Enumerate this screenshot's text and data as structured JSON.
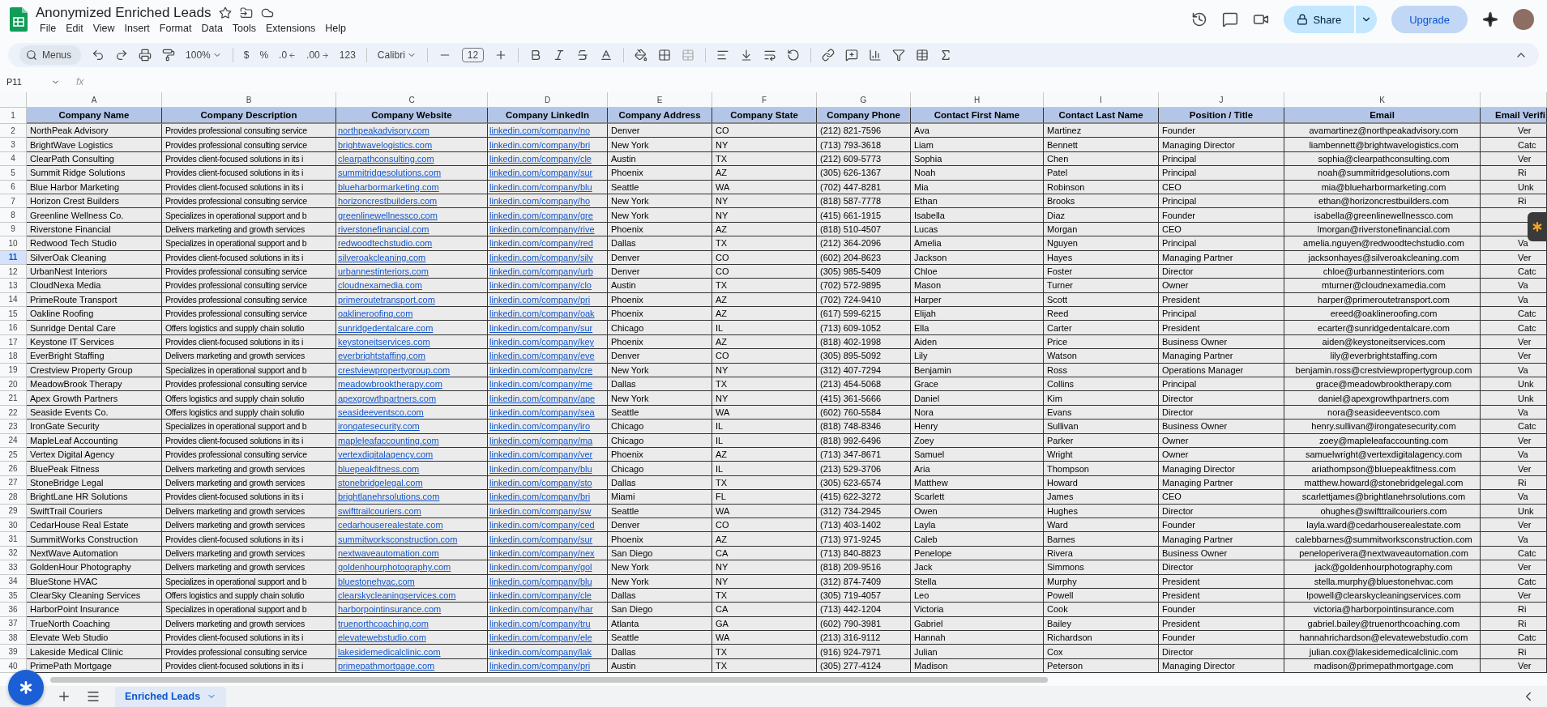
{
  "document": {
    "title": "Anonymized Enriched Leads"
  },
  "menu": [
    "File",
    "Edit",
    "View",
    "Insert",
    "Format",
    "Data",
    "Tools",
    "Extensions",
    "Help"
  ],
  "share_button": "Share",
  "upgrade_button": "Upgrade",
  "toolbar": {
    "search": "Menus",
    "zoom": "100%",
    "currency": "$",
    "percent": "%",
    "decrease_decimal": ".0",
    "increase_decimal": ".00",
    "number_format": "123",
    "font": "Calibri",
    "font_size": "12"
  },
  "name_box": "P11",
  "formula_label": "fx",
  "columns": [
    {
      "letter": "A",
      "header": "Company Name",
      "kind": "text"
    },
    {
      "letter": "B",
      "header": "Company Description",
      "kind": "desc"
    },
    {
      "letter": "C",
      "header": "Company Website",
      "kind": "link"
    },
    {
      "letter": "D",
      "header": "Company LinkedIn",
      "kind": "link"
    },
    {
      "letter": "E",
      "header": "Company Address",
      "kind": "text"
    },
    {
      "letter": "F",
      "header": "Company State",
      "kind": "text"
    },
    {
      "letter": "G",
      "header": "Company Phone",
      "kind": "text"
    },
    {
      "letter": "H",
      "header": "Contact First Name",
      "kind": "text"
    },
    {
      "letter": "I",
      "header": "Contact Last Name",
      "kind": "text"
    },
    {
      "letter": "J",
      "header": "Position / Title",
      "kind": "text"
    },
    {
      "letter": "K",
      "header": "Email",
      "kind": "center"
    },
    {
      "header": "Email Verifi",
      "kind": "clipped"
    }
  ],
  "header_row": {
    "number": "1"
  },
  "rows": [
    {
      "number": "2",
      "selected": false,
      "cells": [
        "NorthPeak Advisory",
        "Provides professional consulting service",
        "northpeakadvisory.com",
        "linkedin.com/company/no",
        "Denver",
        "CO",
        "(212) 821-7596",
        "Ava",
        "Martinez",
        "Founder",
        "avamartinez@northpeakadvisory.com",
        "Ver"
      ]
    },
    {
      "number": "3",
      "selected": false,
      "cells": [
        "BrightWave Logistics",
        "Provides professional consulting service",
        "brightwavelogistics.com",
        "linkedin.com/company/bri",
        "New York",
        "NY",
        "(713) 793-3618",
        "Liam",
        "Bennett",
        "Managing Director",
        "liambennett@brightwavelogistics.com",
        "Catc"
      ]
    },
    {
      "number": "4",
      "selected": false,
      "cells": [
        "ClearPath Consulting",
        "Provides client-focused solutions in its i",
        "clearpathconsulting.com",
        "linkedin.com/company/cle",
        "Austin",
        "TX",
        "(212) 609-5773",
        "Sophia",
        "Chen",
        "Principal",
        "sophia@clearpathconsulting.com",
        "Ver"
      ]
    },
    {
      "number": "5",
      "selected": false,
      "cells": [
        "Summit Ridge Solutions",
        "Provides client-focused solutions in its i",
        "summitridgesolutions.com",
        "linkedin.com/company/sur",
        "Phoenix",
        "AZ",
        "(305) 626-1367",
        "Noah",
        "Patel",
        "Principal",
        "noah@summitridgesolutions.com",
        "Ri"
      ]
    },
    {
      "number": "6",
      "selected": false,
      "cells": [
        "Blue Harbor Marketing",
        "Provides client-focused solutions in its i",
        "blueharbormarketing.com",
        "linkedin.com/company/blu",
        "Seattle",
        "WA",
        "(702) 447-8281",
        "Mia",
        "Robinson",
        "CEO",
        "mia@blueharbormarketing.com",
        "Unk"
      ]
    },
    {
      "number": "7",
      "selected": false,
      "cells": [
        "Horizon Crest Builders",
        "Provides professional consulting service",
        "horizoncrestbuilders.com",
        "linkedin.com/company/ho",
        "New York",
        "NY",
        "(818) 587-7778",
        "Ethan",
        "Brooks",
        "Principal",
        "ethan@horizoncrestbuilders.com",
        "Ri"
      ]
    },
    {
      "number": "8",
      "selected": false,
      "cells": [
        "Greenline Wellness Co.",
        "Specializes in operational support and b",
        "greenlinewellnessco.com",
        "linkedin.com/company/gre",
        "New York",
        "NY",
        "(415) 661-1915",
        "Isabella",
        "Diaz",
        "Founder",
        "isabella@greenlinewellnessco.com"
      ]
    },
    {
      "number": "9",
      "selected": false,
      "cells": [
        "Riverstone Financial",
        "Delivers marketing and growth services",
        "riverstonefinancial.com",
        "linkedin.com/company/rive",
        "Phoenix",
        "AZ",
        "(818) 510-4507",
        "Lucas",
        "Morgan",
        "CEO",
        "lmorgan@riverstonefinancial.com"
      ]
    },
    {
      "number": "10",
      "selected": false,
      "cells": [
        "Redwood Tech Studio",
        "Specializes in operational support and b",
        "redwoodtechstudio.com",
        "linkedin.com/company/red",
        "Dallas",
        "TX",
        "(212) 364-2096",
        "Amelia",
        "Nguyen",
        "Principal",
        "amelia.nguyen@redwoodtechstudio.com",
        "Va"
      ]
    },
    {
      "number": "11",
      "selected": true,
      "cells": [
        "SilverOak Cleaning",
        "Provides client-focused solutions in its i",
        "silveroakcleaning.com",
        "linkedin.com/company/silv",
        "Denver",
        "CO",
        "(602) 204-8623",
        "Jackson",
        "Hayes",
        "Managing Partner",
        "jacksonhayes@silveroakcleaning.com",
        "Ver"
      ]
    },
    {
      "number": "12",
      "selected": false,
      "cells": [
        "UrbanNest Interiors",
        "Provides professional consulting service",
        "urbannestinteriors.com",
        "linkedin.com/company/urb",
        "Denver",
        "CO",
        "(305) 985-5409",
        "Chloe",
        "Foster",
        "Director",
        "chloe@urbannestinteriors.com",
        "Catc"
      ]
    },
    {
      "number": "13",
      "selected": false,
      "cells": [
        "CloudNexa Media",
        "Provides professional consulting service",
        "cloudnexamedia.com",
        "linkedin.com/company/clo",
        "Austin",
        "TX",
        "(702) 572-9895",
        "Mason",
        "Turner",
        "Owner",
        "mturner@cloudnexamedia.com",
        "Va"
      ]
    },
    {
      "number": "14",
      "selected": false,
      "cells": [
        "PrimeRoute Transport",
        "Provides professional consulting service",
        "primeroutetransport.com",
        "linkedin.com/company/pri",
        "Phoenix",
        "AZ",
        "(702) 724-9410",
        "Harper",
        "Scott",
        "President",
        "harper@primeroutetransport.com",
        "Va"
      ]
    },
    {
      "number": "15",
      "selected": false,
      "cells": [
        "Oakline Roofing",
        "Provides professional consulting service",
        "oaklineroofing.com",
        "linkedin.com/company/oak",
        "Phoenix",
        "AZ",
        "(617) 599-6215",
        "Elijah",
        "Reed",
        "Principal",
        "ereed@oaklineroofing.com",
        "Catc"
      ]
    },
    {
      "number": "16",
      "selected": false,
      "cells": [
        "Sunridge Dental Care",
        "Offers logistics and supply chain solutio",
        "sunridgedentalcare.com",
        "linkedin.com/company/sur",
        "Chicago",
        "IL",
        "(713) 609-1052",
        "Ella",
        "Carter",
        "President",
        "ecarter@sunridgedentalcare.com",
        "Catc"
      ]
    },
    {
      "number": "17",
      "selected": false,
      "cells": [
        "Keystone IT Services",
        "Provides client-focused solutions in its i",
        "keystoneitservices.com",
        "linkedin.com/company/key",
        "Phoenix",
        "AZ",
        "(818) 402-1998",
        "Aiden",
        "Price",
        "Business Owner",
        "aiden@keystoneitservices.com",
        "Ver"
      ]
    },
    {
      "number": "18",
      "selected": false,
      "cells": [
        "EverBright Staffing",
        "Delivers marketing and growth services",
        "everbrightstaffing.com",
        "linkedin.com/company/eve",
        "Denver",
        "CO",
        "(305) 895-5092",
        "Lily",
        "Watson",
        "Managing Partner",
        "lily@everbrightstaffing.com",
        "Ver"
      ]
    },
    {
      "number": "19",
      "selected": false,
      "cells": [
        "Crestview Property Group",
        "Specializes in operational support and b",
        "crestviewpropertygroup.com",
        "linkedin.com/company/cre",
        "New York",
        "NY",
        "(312) 407-7294",
        "Benjamin",
        "Ross",
        "Operations Manager",
        "benjamin.ross@crestviewpropertygroup.com",
        "Va"
      ]
    },
    {
      "number": "20",
      "selected": false,
      "cells": [
        "MeadowBrook Therapy",
        "Provides professional consulting service",
        "meadowbrooktherapy.com",
        "linkedin.com/company/me",
        "Dallas",
        "TX",
        "(213) 454-5068",
        "Grace",
        "Collins",
        "Principal",
        "grace@meadowbrooktherapy.com",
        "Unk"
      ]
    },
    {
      "number": "21",
      "selected": false,
      "cells": [
        "Apex Growth Partners",
        "Offers logistics and supply chain solutio",
        "apexgrowthpartners.com",
        "linkedin.com/company/ape",
        "New York",
        "NY",
        "(415) 361-5666",
        "Daniel",
        "Kim",
        "Director",
        "daniel@apexgrowthpartners.com",
        "Unk"
      ]
    },
    {
      "number": "22",
      "selected": false,
      "cells": [
        "Seaside Events Co.",
        "Offers logistics and supply chain solutio",
        "seasideeventsco.com",
        "linkedin.com/company/sea",
        "Seattle",
        "WA",
        "(602) 760-5584",
        "Nora",
        "Evans",
        "Director",
        "nora@seasideeventsco.com",
        "Va"
      ]
    },
    {
      "number": "23",
      "selected": false,
      "cells": [
        "IronGate Security",
        "Specializes in operational support and b",
        "irongatesecurity.com",
        "linkedin.com/company/iro",
        "Chicago",
        "IL",
        "(818) 748-8346",
        "Henry",
        "Sullivan",
        "Business Owner",
        "henry.sullivan@irongatesecurity.com",
        "Catc"
      ]
    },
    {
      "number": "24",
      "selected": false,
      "cells": [
        "MapleLeaf Accounting",
        "Provides client-focused solutions in its i",
        "mapleleafaccounting.com",
        "linkedin.com/company/ma",
        "Chicago",
        "IL",
        "(818) 992-6496",
        "Zoey",
        "Parker",
        "Owner",
        "zoey@mapleleafaccounting.com",
        "Ver"
      ]
    },
    {
      "number": "25",
      "selected": false,
      "cells": [
        "Vertex Digital Agency",
        "Provides professional consulting service",
        "vertexdigitalagency.com",
        "linkedin.com/company/ver",
        "Phoenix",
        "AZ",
        "(713) 347-8671",
        "Samuel",
        "Wright",
        "Owner",
        "samuelwright@vertexdigitalagency.com",
        "Va"
      ]
    },
    {
      "number": "26",
      "selected": false,
      "cells": [
        "BluePeak Fitness",
        "Delivers marketing and growth services",
        "bluepeakfitness.com",
        "linkedin.com/company/blu",
        "Chicago",
        "IL",
        "(213) 529-3706",
        "Aria",
        "Thompson",
        "Managing Director",
        "ariathompson@bluepeakfitness.com",
        "Ver"
      ]
    },
    {
      "number": "27",
      "selected": false,
      "cells": [
        "StoneBridge Legal",
        "Delivers marketing and growth services",
        "stonebridgelegal.com",
        "linkedin.com/company/sto",
        "Dallas",
        "TX",
        "(305) 623-6574",
        "Matthew",
        "Howard",
        "Managing Partner",
        "matthew.howard@stonebridgelegal.com",
        "Ri"
      ]
    },
    {
      "number": "28",
      "selected": false,
      "cells": [
        "BrightLane HR Solutions",
        "Provides client-focused solutions in its i",
        "brightlanehrsolutions.com",
        "linkedin.com/company/bri",
        "Miami",
        "FL",
        "(415) 622-3272",
        "Scarlett",
        "James",
        "CEO",
        "scarlettjames@brightlanehrsolutions.com",
        "Va"
      ]
    },
    {
      "number": "29",
      "selected": false,
      "cells": [
        "SwiftTrail Couriers",
        "Delivers marketing and growth services",
        "swifttrailcouriers.com",
        "linkedin.com/company/sw",
        "Seattle",
        "WA",
        "(312) 734-2945",
        "Owen",
        "Hughes",
        "Director",
        "ohughes@swifttrailcouriers.com",
        "Unk"
      ]
    },
    {
      "number": "30",
      "selected": false,
      "cells": [
        "CedarHouse Real Estate",
        "Delivers marketing and growth services",
        "cedarhouserealestate.com",
        "linkedin.com/company/ced",
        "Denver",
        "CO",
        "(713) 403-1402",
        "Layla",
        "Ward",
        "Founder",
        "layla.ward@cedarhouserealestate.com",
        "Ver"
      ]
    },
    {
      "number": "31",
      "selected": false,
      "cells": [
        "SummitWorks Construction",
        "Provides client-focused solutions in its i",
        "summitworksconstruction.com",
        "linkedin.com/company/sur",
        "Phoenix",
        "AZ",
        "(713) 971-9245",
        "Caleb",
        "Barnes",
        "Managing Partner",
        "calebbarnes@summitworksconstruction.com",
        "Va"
      ]
    },
    {
      "number": "32",
      "selected": false,
      "cells": [
        "NextWave Automation",
        "Delivers marketing and growth services",
        "nextwaveautomation.com",
        "linkedin.com/company/nex",
        "San Diego",
        "CA",
        "(713) 840-8823",
        "Penelope",
        "Rivera",
        "Business Owner",
        "peneloperivera@nextwaveautomation.com",
        "Catc"
      ]
    },
    {
      "number": "33",
      "selected": false,
      "cells": [
        "GoldenHour Photography",
        "Delivers marketing and growth services",
        "goldenhourphotography.com",
        "linkedin.com/company/gol",
        "New York",
        "NY",
        "(818) 209-9516",
        "Jack",
        "Simmons",
        "Director",
        "jack@goldenhourphotography.com",
        "Ver"
      ]
    },
    {
      "number": "34",
      "selected": false,
      "cells": [
        "BlueStone HVAC",
        "Specializes in operational support and b",
        "bluestonehvac.com",
        "linkedin.com/company/blu",
        "New York",
        "NY",
        "(312) 874-7409",
        "Stella",
        "Murphy",
        "President",
        "stella.murphy@bluestonehvac.com",
        "Catc"
      ]
    },
    {
      "number": "35",
      "selected": false,
      "cells": [
        "ClearSky Cleaning Services",
        "Offers logistics and supply chain solutio",
        "clearskycleaningservices.com",
        "linkedin.com/company/cle",
        "Dallas",
        "TX",
        "(305) 719-4057",
        "Leo",
        "Powell",
        "President",
        "lpowell@clearskycleaningservices.com",
        "Ver"
      ]
    },
    {
      "number": "36",
      "selected": false,
      "cells": [
        "HarborPoint Insurance",
        "Specializes in operational support and b",
        "harborpointinsurance.com",
        "linkedin.com/company/har",
        "San Diego",
        "CA",
        "(713) 442-1204",
        "Victoria",
        "Cook",
        "Founder",
        "victoria@harborpointinsurance.com",
        "Ri"
      ]
    },
    {
      "number": "37",
      "selected": false,
      "cells": [
        "TrueNorth Coaching",
        "Delivers marketing and growth services",
        "truenorthcoaching.com",
        "linkedin.com/company/tru",
        "Atlanta",
        "GA",
        "(602) 790-3981",
        "Gabriel",
        "Bailey",
        "President",
        "gabriel.bailey@truenorthcoaching.com",
        "Ri"
      ]
    },
    {
      "number": "38",
      "selected": false,
      "cells": [
        "Elevate Web Studio",
        "Provides client-focused solutions in its i",
        "elevatewebstudio.com",
        "linkedin.com/company/ele",
        "Seattle",
        "WA",
        "(213) 316-9112",
        "Hannah",
        "Richardson",
        "Founder",
        "hannahrichardson@elevatewebstudio.com",
        "Catc"
      ]
    },
    {
      "number": "39",
      "selected": false,
      "cells": [
        "Lakeside Medical Clinic",
        "Provides professional consulting service",
        "lakesidemedicalclinic.com",
        "linkedin.com/company/lak",
        "Dallas",
        "TX",
        "(916) 924-7971",
        "Julian",
        "Cox",
        "Director",
        "julian.cox@lakesidemedicalclinic.com",
        "Ri"
      ]
    },
    {
      "number": "40",
      "selected": false,
      "cells": [
        "PrimePath Mortgage",
        "Provides client-focused solutions in its i",
        "primepathmortgage.com",
        "linkedin.com/company/pri",
        "Austin",
        "TX",
        "(305) 277-4124",
        "Madison",
        "Peterson",
        "Managing Director",
        "madison@primepathmortgage.com",
        "Ver"
      ]
    }
  ],
  "sheet_tabs": [
    {
      "label": "Enriched Leads",
      "selected": true
    }
  ]
}
